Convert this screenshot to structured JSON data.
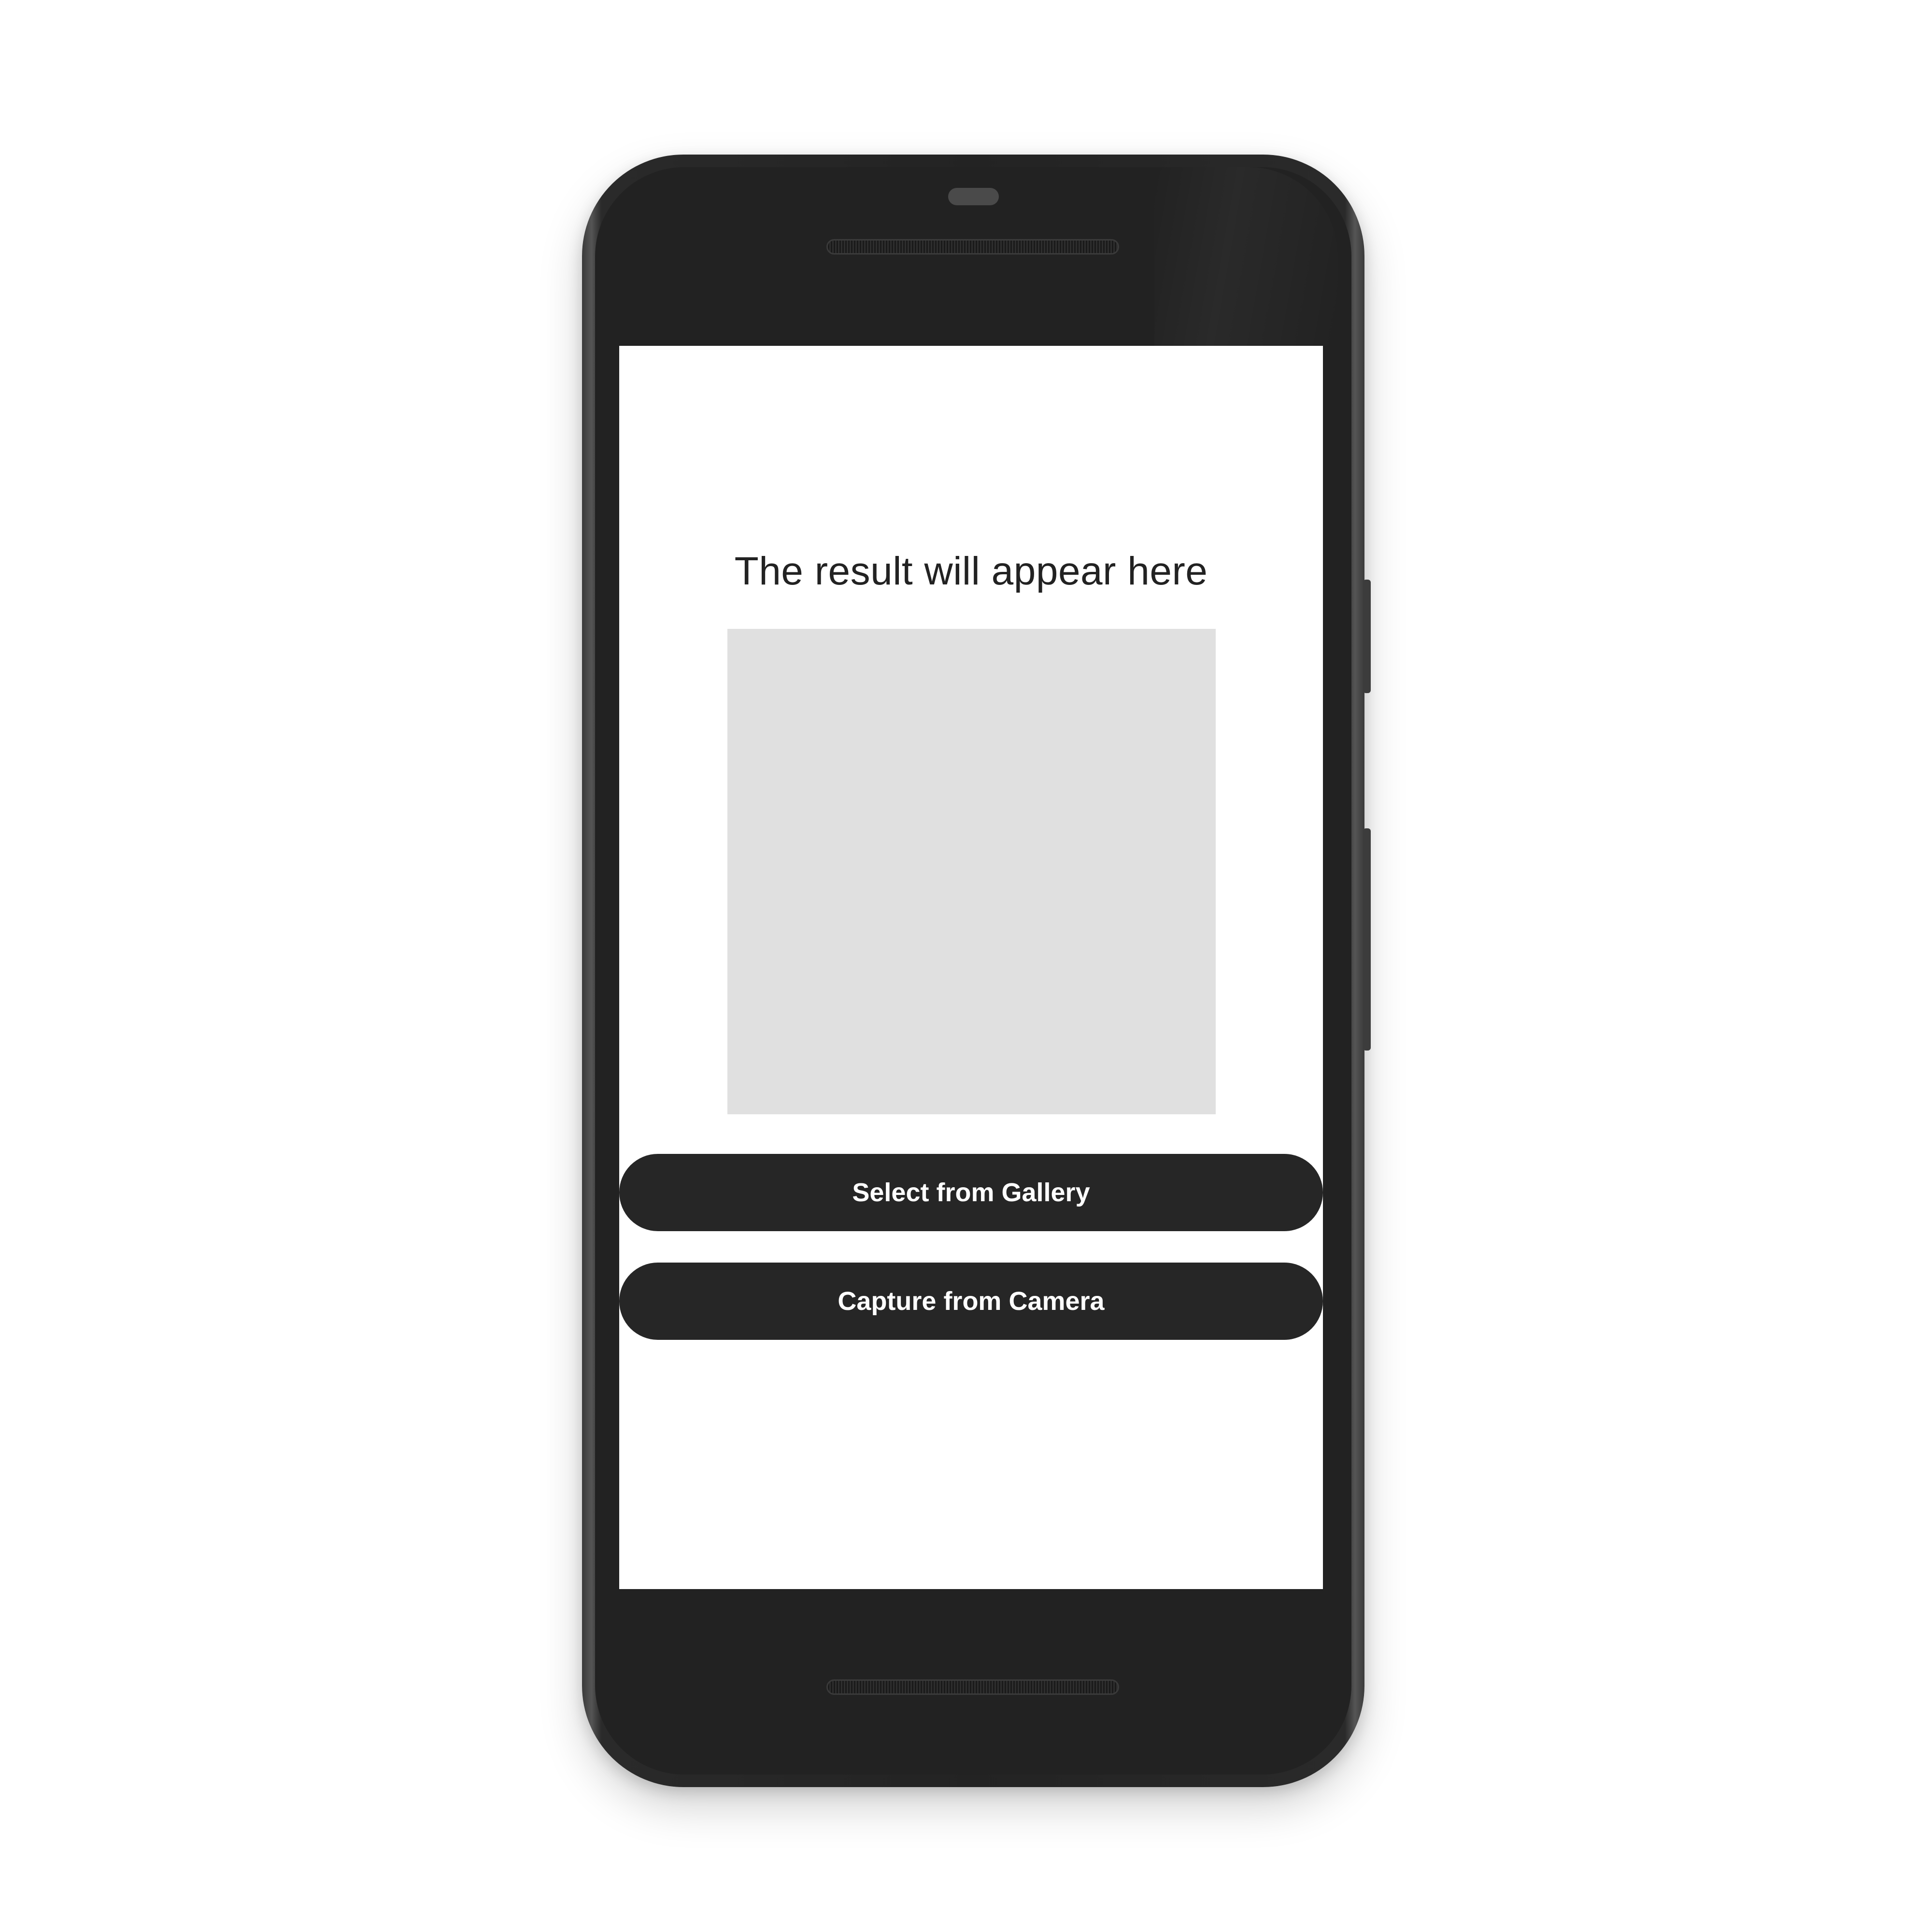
{
  "screen": {
    "result_text": "The result will appear here",
    "buttons": {
      "gallery_label": "Select from Gallery",
      "camera_label": "Capture from Camera"
    }
  },
  "colors": {
    "phone_body": "#232323",
    "screen_background": "#ffffff",
    "image_placeholder": "#e0e0e0",
    "button_background": "#262626",
    "button_text": "#ffffff",
    "title_text": "#222222"
  }
}
